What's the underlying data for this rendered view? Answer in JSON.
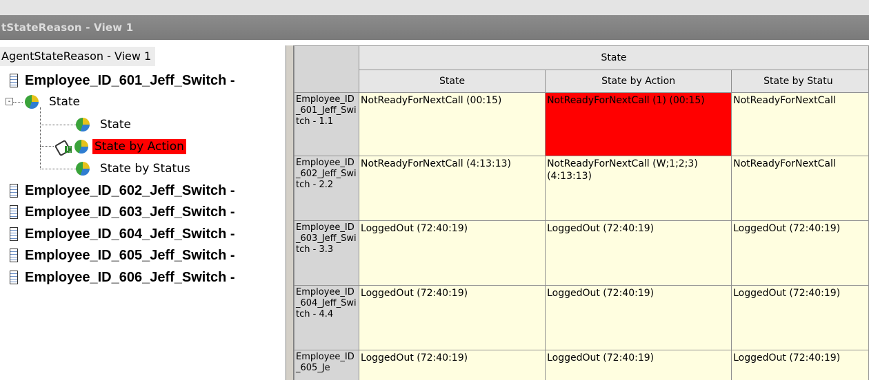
{
  "window": {
    "title": "tStateReason - View 1"
  },
  "tree": {
    "root_label": "AgentStateReason - View 1",
    "employees": [
      "Employee_ID_601_Jeff_Switch -",
      "Employee_ID_602_Jeff_Switch -",
      "Employee_ID_603_Jeff_Switch -",
      "Employee_ID_604_Jeff_Switch -",
      "Employee_ID_605_Jeff_Switch -",
      "Employee_ID_606_Jeff_Switch -"
    ],
    "group_label": "State",
    "group_toggle": "-",
    "children": [
      "State",
      "State by Action",
      "State by Status"
    ],
    "selected_child": "State by Action"
  },
  "grid": {
    "group_header": "State",
    "columns": [
      "State",
      "State by Action",
      "State by Statu"
    ],
    "rows": [
      {
        "header": "Employee_ID_601_Jeff_Switch - 1.1",
        "cells": [
          "NotReadyForNextCall (00:15)",
          "NotReadyForNextCall (1) (00:15)",
          "NotReadyForNextCall"
        ]
      },
      {
        "header": "Employee_ID_602_Jeff_Switch - 2.2",
        "cells": [
          "NotReadyForNextCall (4:13:13)",
          "NotReadyForNextCall (W;1;2;3) (4:13:13)",
          "NotReadyForNextCall"
        ]
      },
      {
        "header": "Employee_ID_603_Jeff_Switch - 3.3",
        "cells": [
          "LoggedOut (72:40:19)",
          "LoggedOut (72:40:19)",
          "LoggedOut (72:40:19)"
        ]
      },
      {
        "header": "Employee_ID_604_Jeff_Switch - 4.4",
        "cells": [
          "LoggedOut (72:40:19)",
          "LoggedOut (72:40:19)",
          "LoggedOut (72:40:19)"
        ]
      },
      {
        "header": "Employee_ID_605_Je",
        "cells": [
          "LoggedOut (72:40:19)",
          "LoggedOut (72:40:19)",
          "LoggedOut (72:40:19)"
        ]
      }
    ],
    "highlight_color": "#ff0000",
    "cell_color": "#fffee0"
  }
}
